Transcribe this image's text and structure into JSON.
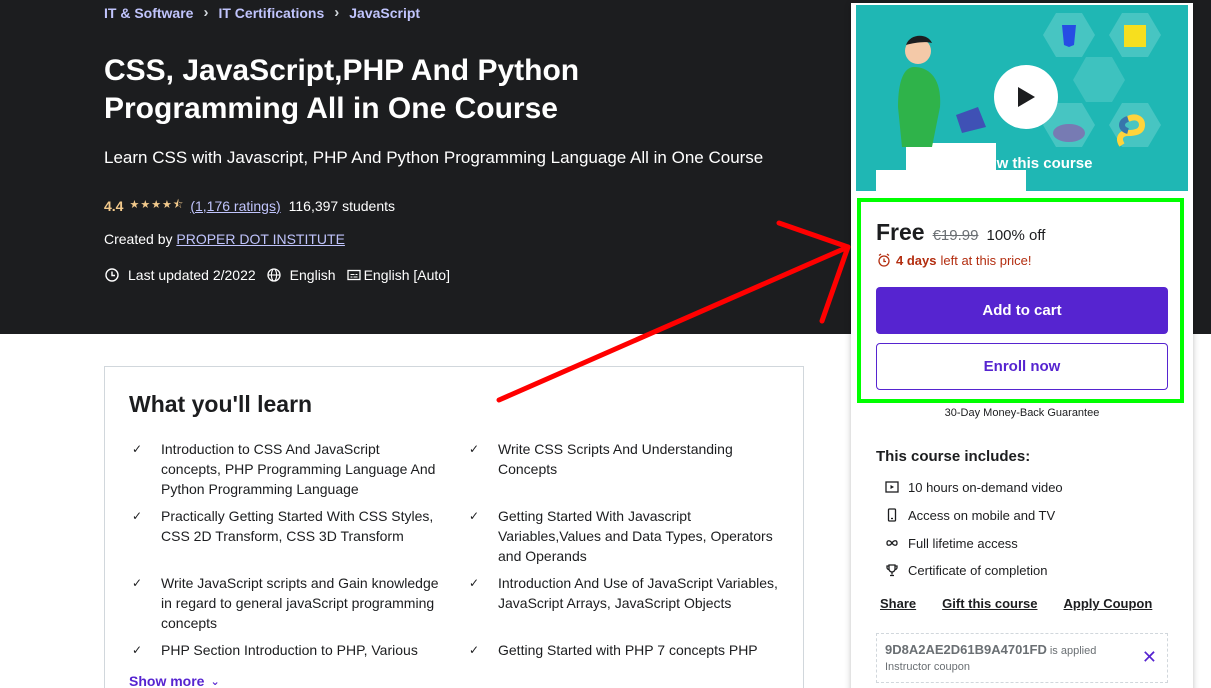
{
  "breadcrumb": [
    "IT & Software",
    "IT Certifications",
    "JavaScript"
  ],
  "course": {
    "title": "CSS, JavaScript,PHP And Python Programming All in One Course",
    "subtitle": "Learn CSS with Javascript, PHP And Python Programming Language All in One Course",
    "rating": "4.4",
    "ratings_count": "(1,176 ratings)",
    "students": "116,397 students",
    "created_by_label": "Created by",
    "instructor": "PROPER DOT INSTITUTE",
    "last_updated": "Last updated 2/2022",
    "language": "English",
    "captions": "English [Auto]"
  },
  "learn": {
    "heading": "What you'll learn",
    "items": [
      "Introduction to CSS And JavaScript concepts, PHP Programming Language And Python Programming Language",
      "Write CSS Scripts And Understanding Concepts",
      "Practically Getting Started With CSS Styles, CSS 2D Transform, CSS 3D Transform",
      "Getting Started With Javascript Variables,Values and Data Types, Operators and Operands",
      "Write JavaScript scripts and Gain knowledge in regard to general javaScript programming concepts",
      "Introduction And Use of JavaScript Variables, JavaScript Arrays, JavaScript Objects",
      "PHP Section Introduction to PHP, Various",
      "Getting Started with PHP 7 concepts PHP"
    ],
    "show_more": "Show more"
  },
  "sidebar": {
    "preview_label": "Preview this course",
    "price": "Free",
    "original_price": "€19.99",
    "discount": "100% off",
    "timer_bold": "4 days",
    "timer_text": "left at this price!",
    "add_to_cart": "Add to cart",
    "enroll_now": "Enroll now",
    "guarantee": "30-Day Money-Back Guarantee",
    "includes_title": "This course includes:",
    "includes": [
      {
        "icon": "video-icon",
        "text": "10 hours on-demand video"
      },
      {
        "icon": "mobile-icon",
        "text": "Access on mobile and TV"
      },
      {
        "icon": "infinity-icon",
        "text": "Full lifetime access"
      },
      {
        "icon": "trophy-icon",
        "text": "Certificate of completion"
      }
    ],
    "share": "Share",
    "gift": "Gift this course",
    "apply_coupon": "Apply Coupon",
    "coupon_code": "9D8A2AE2D61B9A4701FD",
    "coupon_applied": "is applied",
    "coupon_type": "Instructor coupon"
  },
  "colors": {
    "accent": "#5624d0",
    "annotation_arrow": "#ff0000",
    "annotation_box": "#00ff00"
  }
}
